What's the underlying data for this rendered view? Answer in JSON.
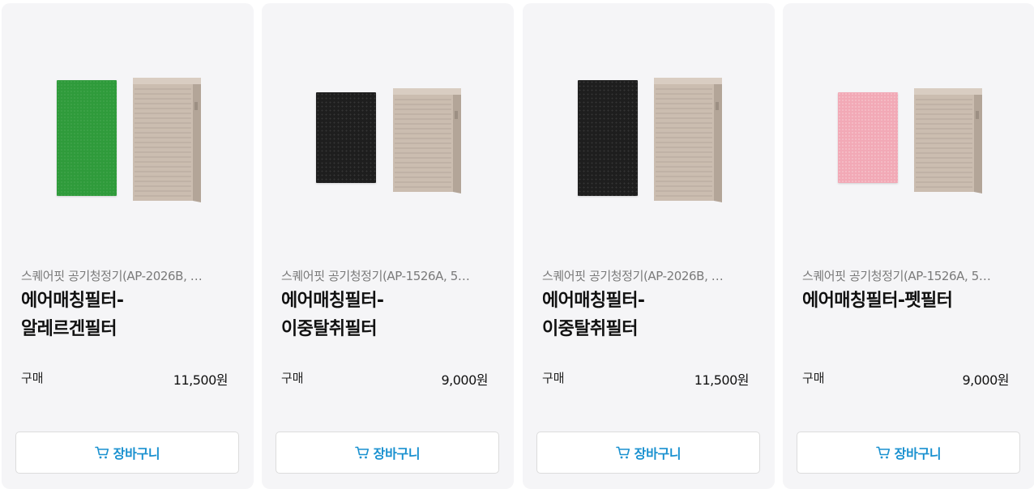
{
  "products": [
    {
      "subtitle": "스퀘어핏 공기청정기(AP-2026B, …",
      "title": "에어매칭필터-\n알레르겐필터",
      "buy_label": "구매",
      "price": "11,500원",
      "cart_label": "장바구니",
      "filter_color": "#2e9a3c",
      "filter_name": "allergen-filter"
    },
    {
      "subtitle": "스퀘어핏 공기청정기(AP-1526A, 5…",
      "title": "에어매칭필터-\n이중탈취필터",
      "buy_label": "구매",
      "price": "9,000원",
      "cart_label": "장바구니",
      "filter_color": "#1e1e1e",
      "filter_name": "deodorizing-filter"
    },
    {
      "subtitle": "스퀘어핏 공기청정기(AP-2026B, …",
      "title": "에어매칭필터-\n이중탈취필터",
      "buy_label": "구매",
      "price": "11,500원",
      "cart_label": "장바구니",
      "filter_color": "#1e1e1e",
      "filter_name": "deodorizing-filter"
    },
    {
      "subtitle": "스퀘어핏 공기청정기(AP-1526A, 5…",
      "title": "에어매칭필터-펫필터",
      "buy_label": "구매",
      "price": "9,000원",
      "cart_label": "장바구니",
      "filter_color": "#f2a6b4",
      "filter_name": "pet-filter"
    }
  ],
  "colors": {
    "card_bg": "#f5f5f7",
    "accent": "#1a91d0",
    "purifier_body": "#cdbfb2"
  },
  "icons": {
    "cart": "shopping-cart-icon"
  }
}
